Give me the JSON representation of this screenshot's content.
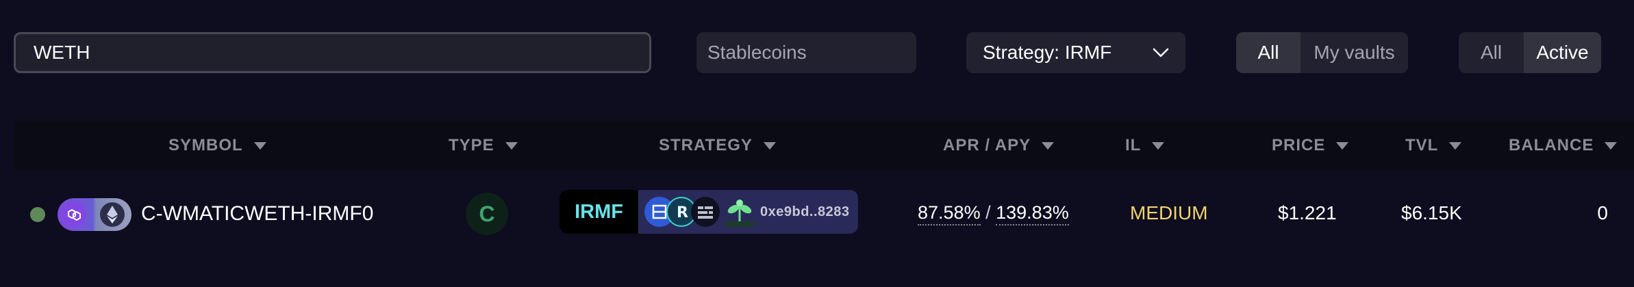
{
  "filters": {
    "search_value": "WETH",
    "stablecoins_placeholder": "Stablecoins",
    "strategy_label": "Strategy: IRMF",
    "vault_scope": {
      "options": [
        "All",
        "My vaults"
      ],
      "selected": "All"
    },
    "status_scope": {
      "options": [
        "All",
        "Active"
      ],
      "selected": "Active"
    }
  },
  "table": {
    "columns": [
      "SYMBOL",
      "TYPE",
      "STRATEGY",
      "APR / APY",
      "IL",
      "PRICE",
      "TVL",
      "BALANCE"
    ],
    "rows": [
      {
        "status_color": "#5e8a5b",
        "token_icons": [
          "polygon-matic-icon",
          "ethereum-icon"
        ],
        "symbol": "C-WMATICWETH-IRMF0",
        "type": "C",
        "strategy_tag": "IRMF",
        "strategy_icons": [
          "quickswap-icon",
          "retro-icon",
          "data-stack-icon",
          "plant-icon"
        ],
        "strategy_address": "0xe9bd..8283",
        "apr": "87.58%",
        "apy": "139.83%",
        "apr_separator": "/",
        "il": "MEDIUM",
        "price": "$1.221",
        "tvl": "$6.15K",
        "balance": "0"
      }
    ]
  },
  "colors": {
    "background": "#0e0c1f",
    "il_medium": "#f1d36e",
    "strategy_tag_text": "#67e3ea",
    "type_badge": "#40a36c"
  }
}
